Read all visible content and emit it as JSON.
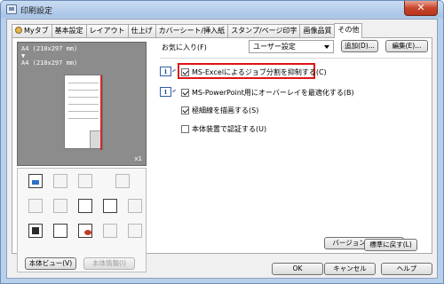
{
  "window": {
    "title": "印刷設定",
    "close_glyph": "✕"
  },
  "tabs": [
    {
      "label": "Myタブ",
      "active": false,
      "has_icon": true
    },
    {
      "label": "基本設定",
      "active": false
    },
    {
      "label": "レイアウト",
      "active": false
    },
    {
      "label": "仕上げ",
      "active": false
    },
    {
      "label": "カバーシート/挿入紙",
      "active": false
    },
    {
      "label": "スタンプ/ページ印字",
      "active": false
    },
    {
      "label": "画像品質",
      "active": false
    },
    {
      "label": "その他",
      "active": true
    }
  ],
  "preview": {
    "paper_text": "A4 (210x297 mm)\n▼\nA4 (210x297 mm)",
    "copies": "x1"
  },
  "left_buttons": {
    "printer_view": "本体ビュー(V)",
    "printer_info": "本体情報(I)"
  },
  "favorites": {
    "label": "お気に入り(F)",
    "selected": "ユーザー設定",
    "add_button": "追加(D)...",
    "edit_button": "編集(E)..."
  },
  "options": [
    {
      "label": "MS-Excelによるジョブ分割を抑制する(C)",
      "checked": true,
      "info": true,
      "highlighted": true
    },
    {
      "label": "MS-PowerPoint用にオーバーレイを最適化する(B)",
      "checked": true,
      "info": true
    },
    {
      "label": "極細線を描画する(S)",
      "checked": true,
      "info": false
    },
    {
      "label": "本体装置で認証する(U)",
      "checked": false,
      "info": false
    }
  ],
  "version_button": "バージョン情報(O)...",
  "default_button": "標準に戻す(L)",
  "footer": {
    "ok": "OK",
    "cancel": "キャンセル",
    "help": "ヘルプ"
  },
  "colors": {
    "highlight": "#e01414",
    "title_bar": "#b9d0ec",
    "close_button": "#c8462b"
  }
}
